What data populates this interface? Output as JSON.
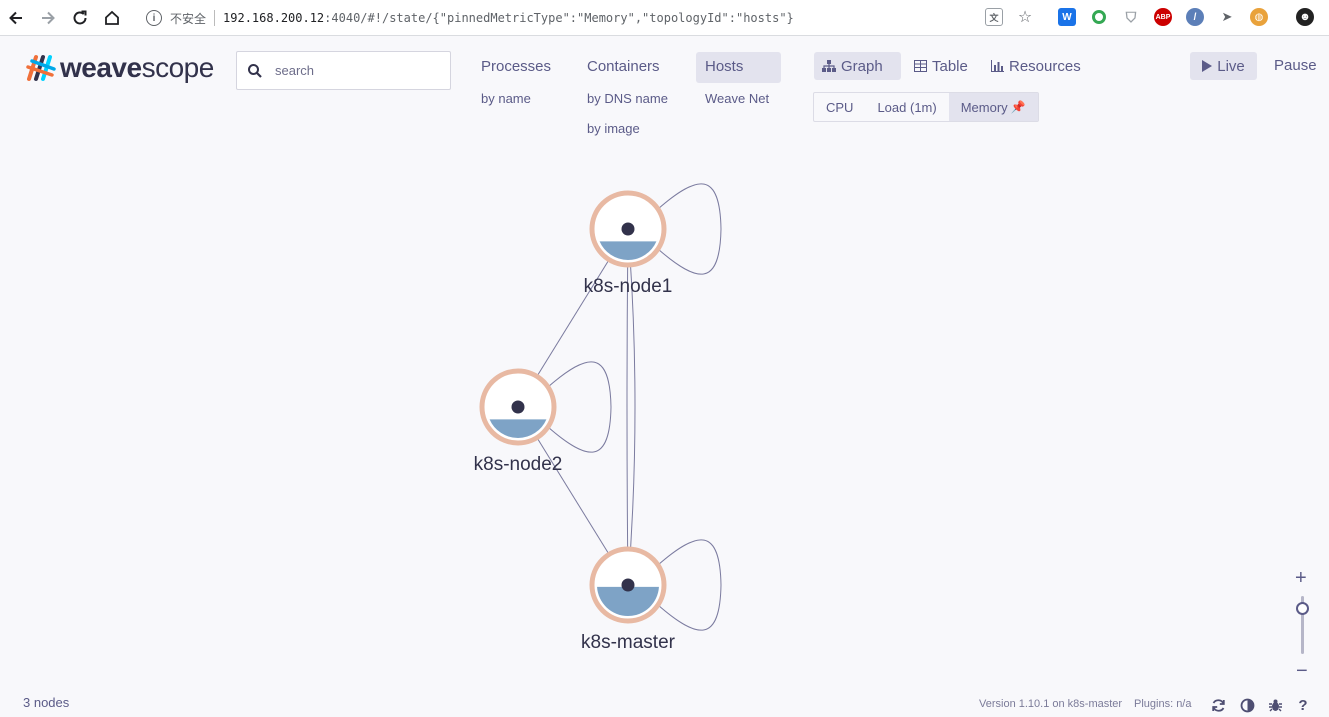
{
  "browser": {
    "insecure_label": "不安全",
    "url_host": "192.168.200.12",
    "url_rest": ":4040/#!/state/{\"pinnedMetricType\":\"Memory\",\"topologyId\":\"hosts\"}"
  },
  "app": {
    "logo_bold": "weave",
    "logo_light": "scope"
  },
  "search": {
    "placeholder": "search"
  },
  "topologies": {
    "processes": {
      "label": "Processes",
      "sub": [
        "by name"
      ]
    },
    "containers": {
      "label": "Containers",
      "sub": [
        "by DNS name",
        "by image"
      ]
    },
    "hosts": {
      "label": "Hosts",
      "sub": [
        "Weave Net"
      ],
      "active": true
    }
  },
  "views": {
    "graph": "Graph",
    "table": "Table",
    "resources": "Resources",
    "active": "graph"
  },
  "metrics": {
    "cpu": "CPU",
    "load": "Load (1m)",
    "memory": "Memory",
    "pinned": "memory"
  },
  "controls": {
    "live": "Live",
    "pause": "Pause"
  },
  "graph": {
    "nodes": [
      {
        "id": "k8s-node1",
        "label": "k8s-node1",
        "memory_fill": 0.3
      },
      {
        "id": "k8s-node2",
        "label": "k8s-node2",
        "memory_fill": 0.3
      },
      {
        "id": "k8s-master",
        "label": "k8s-master",
        "memory_fill": 0.47
      }
    ],
    "edges": [
      [
        "k8s-node1",
        "k8s-node2"
      ],
      [
        "k8s-node1",
        "k8s-master"
      ],
      [
        "k8s-node2",
        "k8s-master"
      ]
    ],
    "colors": {
      "ring": "#e8b9a3",
      "fill": "#7ea3c6",
      "edge": "#5b5b88",
      "center": "#32324b"
    }
  },
  "footer": {
    "node_count": "3 nodes",
    "version": "Version 1.10.1 on k8s-master",
    "plugins": "Plugins: n/a"
  }
}
